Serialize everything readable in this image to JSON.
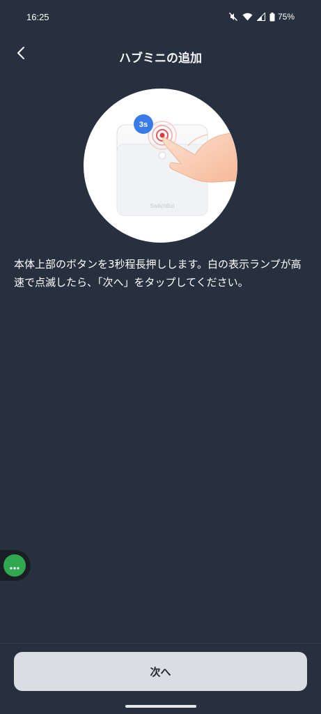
{
  "status_bar": {
    "time": "16:25",
    "battery": "75%",
    "icons": [
      "mute-icon",
      "wifi-icon",
      "signal-icon",
      "battery-icon"
    ]
  },
  "header": {
    "title": "ハブミニの追加",
    "back_icon": "chevron-left-icon"
  },
  "illustration": {
    "badge": "3s",
    "device_brand": "SwitchBot"
  },
  "instruction": "本体上部のボタンを3秒程長押しします。白の表示ランプが高速で点滅したら、「次へ」をタップしてください。",
  "assist_button": {
    "icon": "more-dots-icon",
    "color": "#2fa84f"
  },
  "footer": {
    "next_label": "次へ"
  },
  "colors": {
    "background": "#27303f",
    "button": "#dadde1",
    "badge": "#3b7be8"
  }
}
